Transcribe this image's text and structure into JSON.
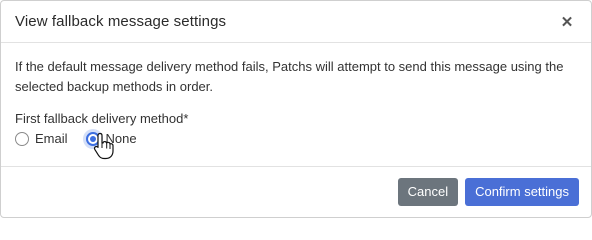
{
  "dialog": {
    "title": "View fallback message settings",
    "close_icon": "close-icon"
  },
  "body": {
    "description": "If the default message delivery method fails, Patchs will attempt to send this message using the selected backup methods in order.",
    "field_label": "First fallback delivery method*",
    "options": [
      {
        "label": "Email",
        "selected": false
      },
      {
        "label": "None",
        "selected": true
      }
    ]
  },
  "footer": {
    "cancel_label": "Cancel",
    "confirm_label": "Confirm settings"
  },
  "colors": {
    "accent": "#4a6fd6",
    "radio_selected": "#3c6ee0",
    "cancel_bg": "#6c757d"
  },
  "cursor": "hand-pointer-icon"
}
